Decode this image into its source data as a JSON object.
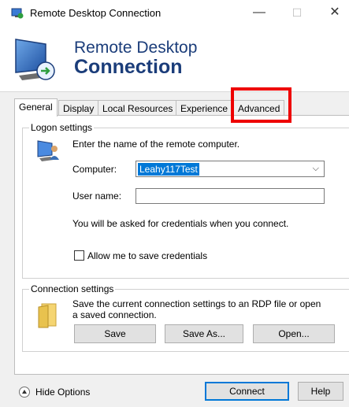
{
  "window": {
    "title": "Remote Desktop Connection",
    "minimize_glyph": "—",
    "maximize_glyph": "☐",
    "close_glyph": "✕"
  },
  "banner": {
    "line1": "Remote Desktop",
    "line2": "Connection"
  },
  "tabs": [
    {
      "label": "General",
      "active": true
    },
    {
      "label": "Display",
      "active": false
    },
    {
      "label": "Local Resources",
      "active": false
    },
    {
      "label": "Experience",
      "active": false
    },
    {
      "label": "Advanced",
      "active": false
    }
  ],
  "logon": {
    "group_label": "Logon settings",
    "instruction": "Enter the name of the remote computer.",
    "computer_label": "Computer:",
    "computer_value": "Leahy117Test",
    "username_label": "User name:",
    "username_value": "",
    "credentials_note": "You will be asked for credentials when you connect.",
    "save_credentials_label": "Allow me to save credentials",
    "save_credentials_checked": false
  },
  "connection": {
    "group_label": "Connection settings",
    "description": "Save the current connection settings to an RDP file or open a saved connection.",
    "save_label": "Save",
    "save_as_label": "Save As...",
    "open_label": "Open..."
  },
  "footer": {
    "hide_options_label": "Hide Options",
    "connect_label": "Connect",
    "help_label": "Help"
  },
  "colors": {
    "highlight": "#e00000",
    "brand": "#1b3d7a",
    "selection": "#0078d7"
  }
}
